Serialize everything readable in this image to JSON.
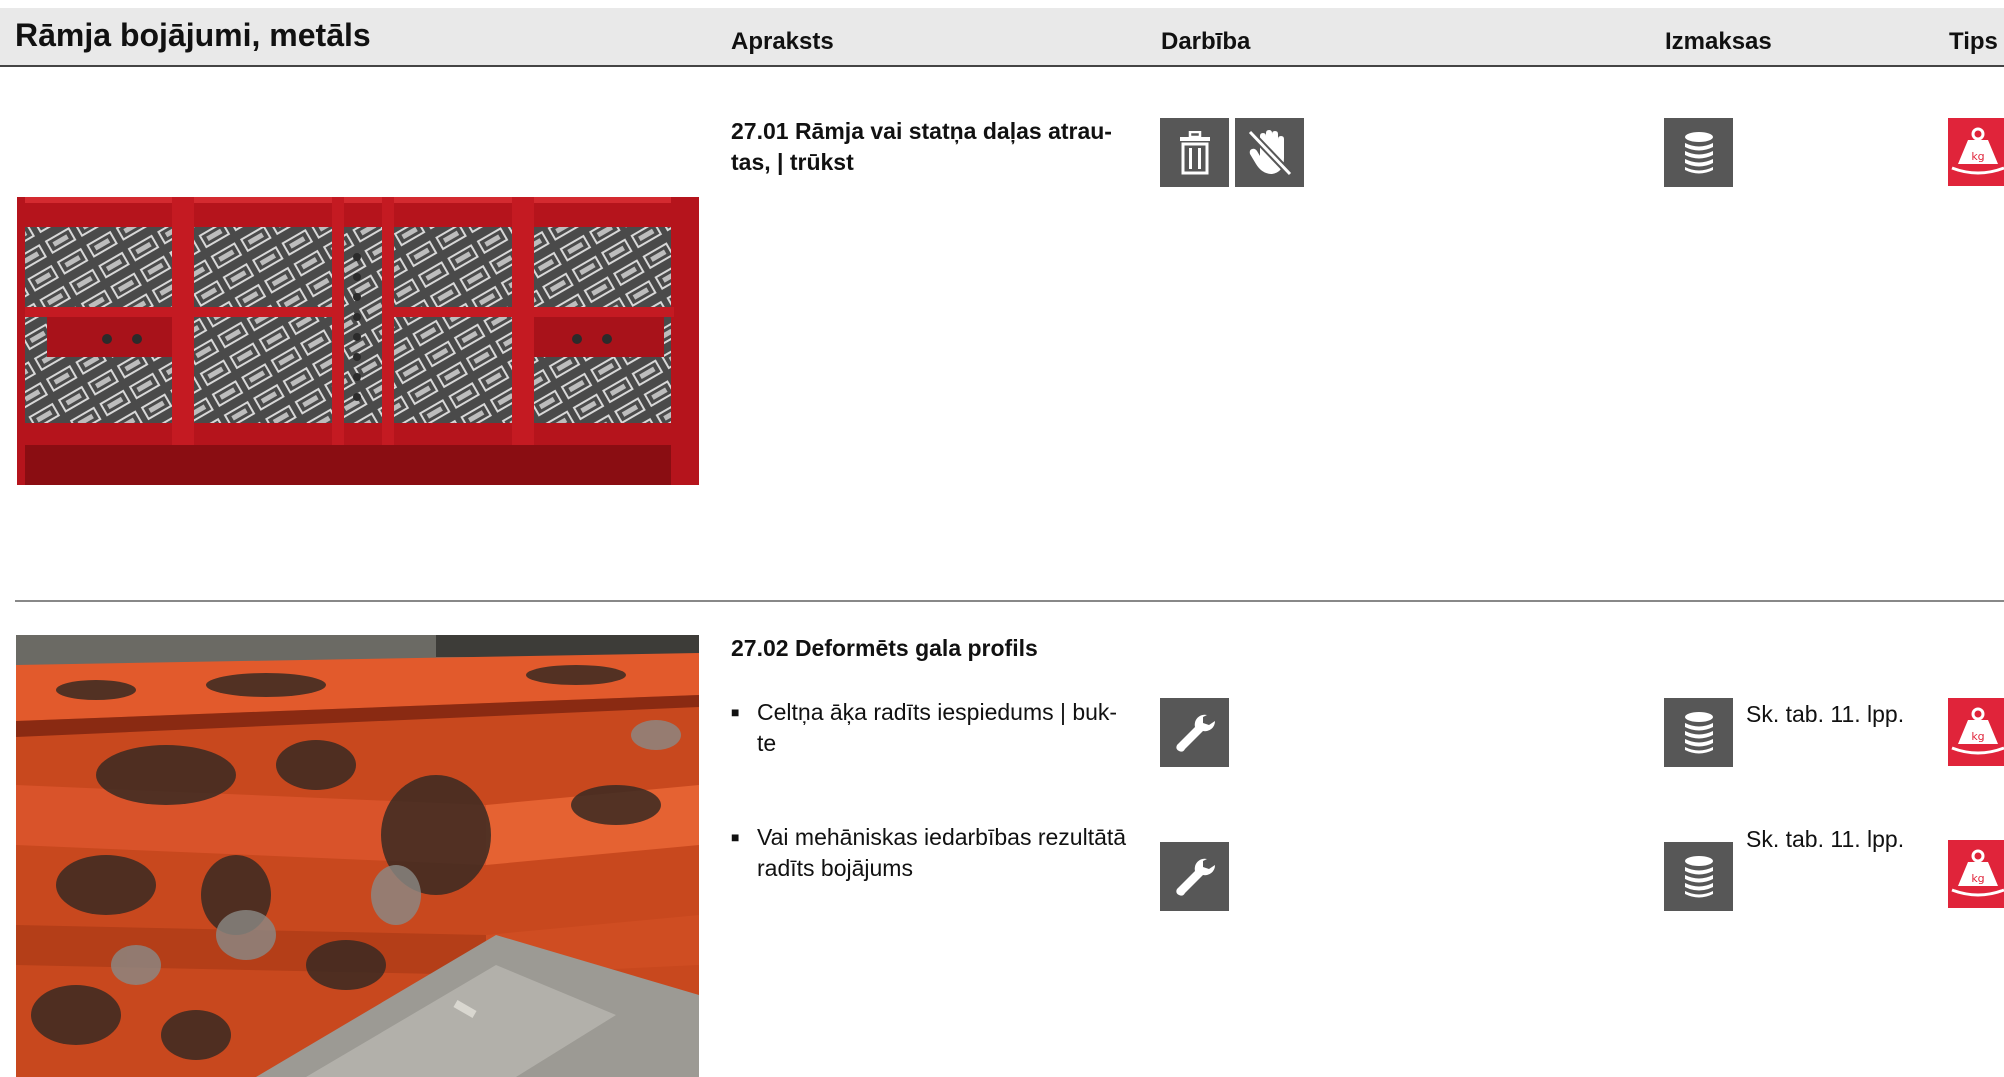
{
  "header": {
    "title": "Rāmja bojājumi, metāls",
    "col_description": "Apraksts",
    "col_action": "Darbība",
    "col_cost": "Izmaksas",
    "col_type": "Tips"
  },
  "sections": [
    {
      "title": "27.01 Rāmja vai statņa daļas atrau-\ntas, | trūkst",
      "actions": [
        "trash-icon",
        "no-hand-icon"
      ],
      "cost_icon": "coin-stack-icon",
      "type_icon": "weight-kg-icon"
    },
    {
      "title": "27.02 Deformēts gala profils",
      "items": [
        {
          "text": "Celtņa āķa radīts iespiedums | buk-\nte",
          "action_icon": "wrench-icon",
          "cost_icon": "coin-stack-icon",
          "reference": "Sk. tab. 11. lpp.",
          "type_icon": "weight-kg-icon"
        },
        {
          "text": "Vai mehāniskas iedarbības rezultātā radīts bojājums",
          "action_icon": "wrench-icon",
          "cost_icon": "coin-stack-icon",
          "reference": "Sk. tab. 11. lpp.",
          "type_icon": "weight-kg-icon"
        }
      ]
    }
  ],
  "colors": {
    "header_bg": "#e9e9e9",
    "icon_bg": "#575757",
    "tips_red": "#e0243a",
    "frame_red": "#b5141c",
    "rust_orange": "#e0502a"
  },
  "bullet_mark": "■",
  "tips_label": "kg"
}
